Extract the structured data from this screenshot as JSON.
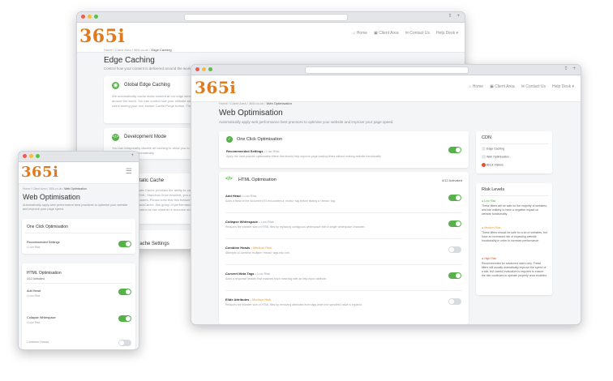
{
  "colors": {
    "accent": "#e07a1f",
    "toggle_on": "#56b149",
    "toggle_off": "#d9dcdf",
    "medium_risk": "#e89c2c",
    "high_risk": "#e0532f"
  },
  "brand": {
    "logo": "365i"
  },
  "nav": {
    "home": "Home",
    "client_area": "Client Area",
    "contact": "Contact Us",
    "help_desk": "Help Desk"
  },
  "back": {
    "crumbs": [
      "Home",
      "Client Area",
      "365i.co.uk",
      "Edge Caching"
    ],
    "title": "Edge Caching",
    "subtitle": "Control how your content is delivered around the world",
    "sections": [
      {
        "title": "Global Edge Caching",
        "body": "We automatically cache static content at our edge servers all your visitors around the world. You can control how your website and want to access all users seeing your non-instant Cache Purge button. The more conten"
      },
      {
        "title": "Development Mode",
        "body": "You can temporarily disable all caching to allow you to see updated data. Caching is then automatically"
      },
      {
        "title": "Static Cache",
        "body": "Static Cache provides the ability to cache static content like HTML, Standout Once enabled, you can choose from Store headers. Please note that this feature is supported with StackCache, this group of performance regardless of visitor location to use whether a resource such"
      },
      {
        "title": "Cache Settings",
        "body": "We cache all we store images of our edge"
      }
    ]
  },
  "main": {
    "crumbs": [
      "Home",
      "Client Area",
      "365i.co.uk",
      "Web Optimisation"
    ],
    "title": "Web Optimisation",
    "subtitle": "Automatically apply web performance best practices to optimise your website and improve your page speed.",
    "one_click": {
      "title": "One Click Optimisation",
      "item_title": "Recommended Settings",
      "item_risk": "• Low Risk",
      "item_desc": "Apply the most popular optimisation filters that should help improve page loading times without making website functionality"
    },
    "html_opt": {
      "title": "HTML Optimisation",
      "count": "4/12 Activated",
      "items": [
        {
          "title": "Add Head",
          "risk": "• Low Risk",
          "desc": "Adds a head to the document if it encounters a <body> tag before finding a <head> tag.",
          "on": true
        },
        {
          "title": "Collapse Whitespace",
          "risk": "• Low Risk",
          "desc": "Reduces the transfer size of HTML files by replacing contiguous whitespace with a single whitespace character.",
          "on": true
        },
        {
          "title": "Combine Heads",
          "risk": "• Medium Risk",
          "desc": "Attempts to combine multiple <head> tags into one.",
          "on": false
        },
        {
          "title": "Convert Meta Tags",
          "risk": "• Low Risk",
          "desc": "Adds a response header that matches each meta tag with an http-equiv attribute.",
          "on": true
        },
        {
          "title": "Elide Attributes",
          "risk": "• Medium Risk",
          "desc": "Reduces the transfer size of HTML files by removing attributes from tags when the specified value is equal to",
          "on": false
        }
      ]
    },
    "cdn": {
      "title": "CDN",
      "items": [
        "Edge Caching",
        "Web Optimisation",
        "Block Visitors"
      ]
    },
    "risk": {
      "title": "Risk Levels",
      "levels": [
        {
          "name": "Low Risk",
          "desc": "These filters will be safe for the majority of websites, and are unlikely to have a negative impact on website functionality."
        },
        {
          "name": "Medium Risk",
          "desc": "These filters should be safe for a lot of websites, but have an increased risk of impacting website functionality in order to increase performance."
        },
        {
          "name": "High Risk",
          "desc": "Recommended for advanced users only. These filters will usually dramatically improve the speed of a site, but careful evaluation is required to ensure the site continues to operate properly once enabled."
        }
      ]
    }
  },
  "mobile": {
    "crumbs": [
      "Home",
      "Client Area",
      "365i.co.uk",
      "Web Optimisation"
    ],
    "title": "Web Optimisation",
    "subtitle": "Automatically apply web performance best practices to optimise your website and improve your page speed.",
    "one_click": {
      "title": "One Click Optimisation",
      "item_title": "Recommended Settings",
      "item_risk": "• Low Risk"
    },
    "html_opt": {
      "title": "HTML Optimisation",
      "count": "4/12 Activated",
      "items": [
        {
          "title": "Add Head",
          "risk": "• Low Risk"
        },
        {
          "title": "Collapse Whitespace",
          "risk": "• Low Risk"
        },
        {
          "title": "Combine Heads",
          "risk": ""
        }
      ]
    }
  }
}
